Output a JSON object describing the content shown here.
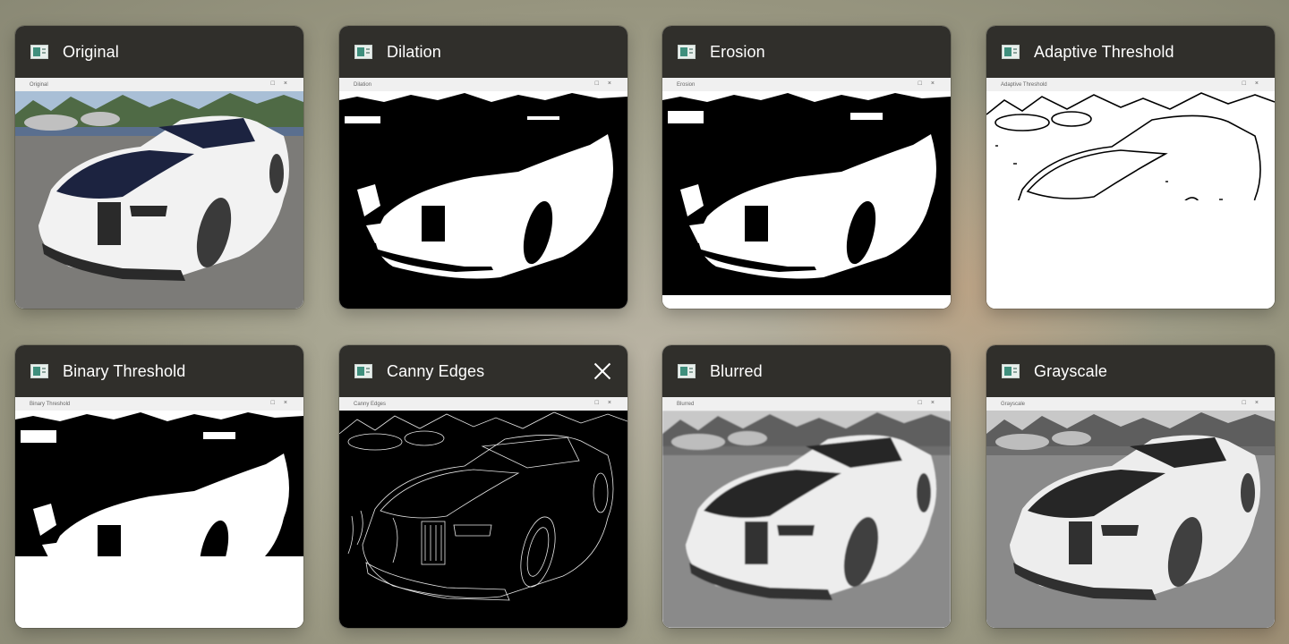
{
  "windows": [
    {
      "title": "Original",
      "inner_title": "Original",
      "filter": "original",
      "fill_fraction": 1.0,
      "active": false,
      "icon": "app-window-icon"
    },
    {
      "title": "Dilation",
      "inner_title": "Dilation",
      "filter": "binary-dilated",
      "fill_fraction": 1.0,
      "active": false,
      "icon": "app-window-icon"
    },
    {
      "title": "Erosion",
      "inner_title": "Erosion",
      "filter": "binary-eroded",
      "fill_fraction": 0.94,
      "active": false,
      "icon": "app-window-icon"
    },
    {
      "title": "Adaptive Threshold",
      "inner_title": "Adaptive Threshold",
      "filter": "adaptive",
      "fill_fraction": 0.5,
      "active": false,
      "icon": "app-window-icon"
    },
    {
      "title": "Binary Threshold",
      "inner_title": "Binary Threshold",
      "filter": "binary",
      "fill_fraction": 0.67,
      "active": false,
      "icon": "app-window-icon"
    },
    {
      "title": "Canny Edges",
      "inner_title": "Canny Edges",
      "filter": "canny",
      "fill_fraction": 1.0,
      "active": true,
      "icon": "app-window-icon"
    },
    {
      "title": "Blurred",
      "inner_title": "Blurred",
      "filter": "gray-blurred",
      "fill_fraction": 1.0,
      "active": false,
      "icon": "app-window-icon"
    },
    {
      "title": "Grayscale",
      "inner_title": "Grayscale",
      "filter": "gray",
      "fill_fraction": 1.0,
      "active": false,
      "icon": "app-window-icon"
    }
  ],
  "inner_controls": [
    "□",
    "×"
  ],
  "close_icon": "close-icon",
  "colors": {
    "titlebar": "#302f2b",
    "title_text": "#ffffff",
    "inner_bar": "#f0f0f0"
  }
}
